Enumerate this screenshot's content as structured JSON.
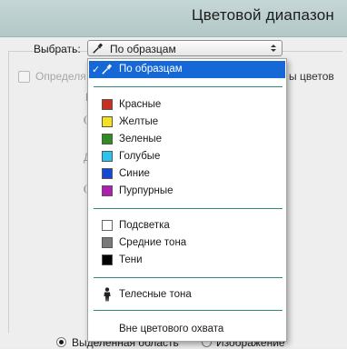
{
  "window": {
    "title": "Цветовой диапазон"
  },
  "select": {
    "label": "Выбрать:",
    "value": "По образцам",
    "icon": "eyedropper-icon"
  },
  "localized": {
    "left_text": "Определя",
    "right_text": "ы цветов"
  },
  "faint": {
    "p": "Р",
    "d": "Д"
  },
  "dropdown": {
    "selected": {
      "label": "По образцам",
      "icon": "eyedropper-icon"
    },
    "colors": [
      {
        "label": "Красные",
        "color": "#c8301b"
      },
      {
        "label": "Желтые",
        "color": "#f6e21a"
      },
      {
        "label": "Зеленые",
        "color": "#2f8c1e"
      },
      {
        "label": "Голубые",
        "color": "#2ac4f2"
      },
      {
        "label": "Синие",
        "color": "#1347d8"
      },
      {
        "label": "Пурпурные",
        "color": "#b21cb5"
      }
    ],
    "tones": [
      {
        "label": "Подсветка",
        "color": "#ffffff"
      },
      {
        "label": "Средние тона",
        "color": "#7a7a7a"
      },
      {
        "label": "Тени",
        "color": "#000000"
      }
    ],
    "skin": {
      "label": "Телесные тона",
      "icon": "person-icon"
    },
    "out_of_gamut": {
      "label": "Вне цветового охвата"
    }
  },
  "preview": {
    "selection_label": "Выделенная область",
    "image_label": "Изображение",
    "selected": "selection"
  },
  "accent": {
    "highlight": "#1668d6",
    "separator": "#2e8a7e"
  }
}
